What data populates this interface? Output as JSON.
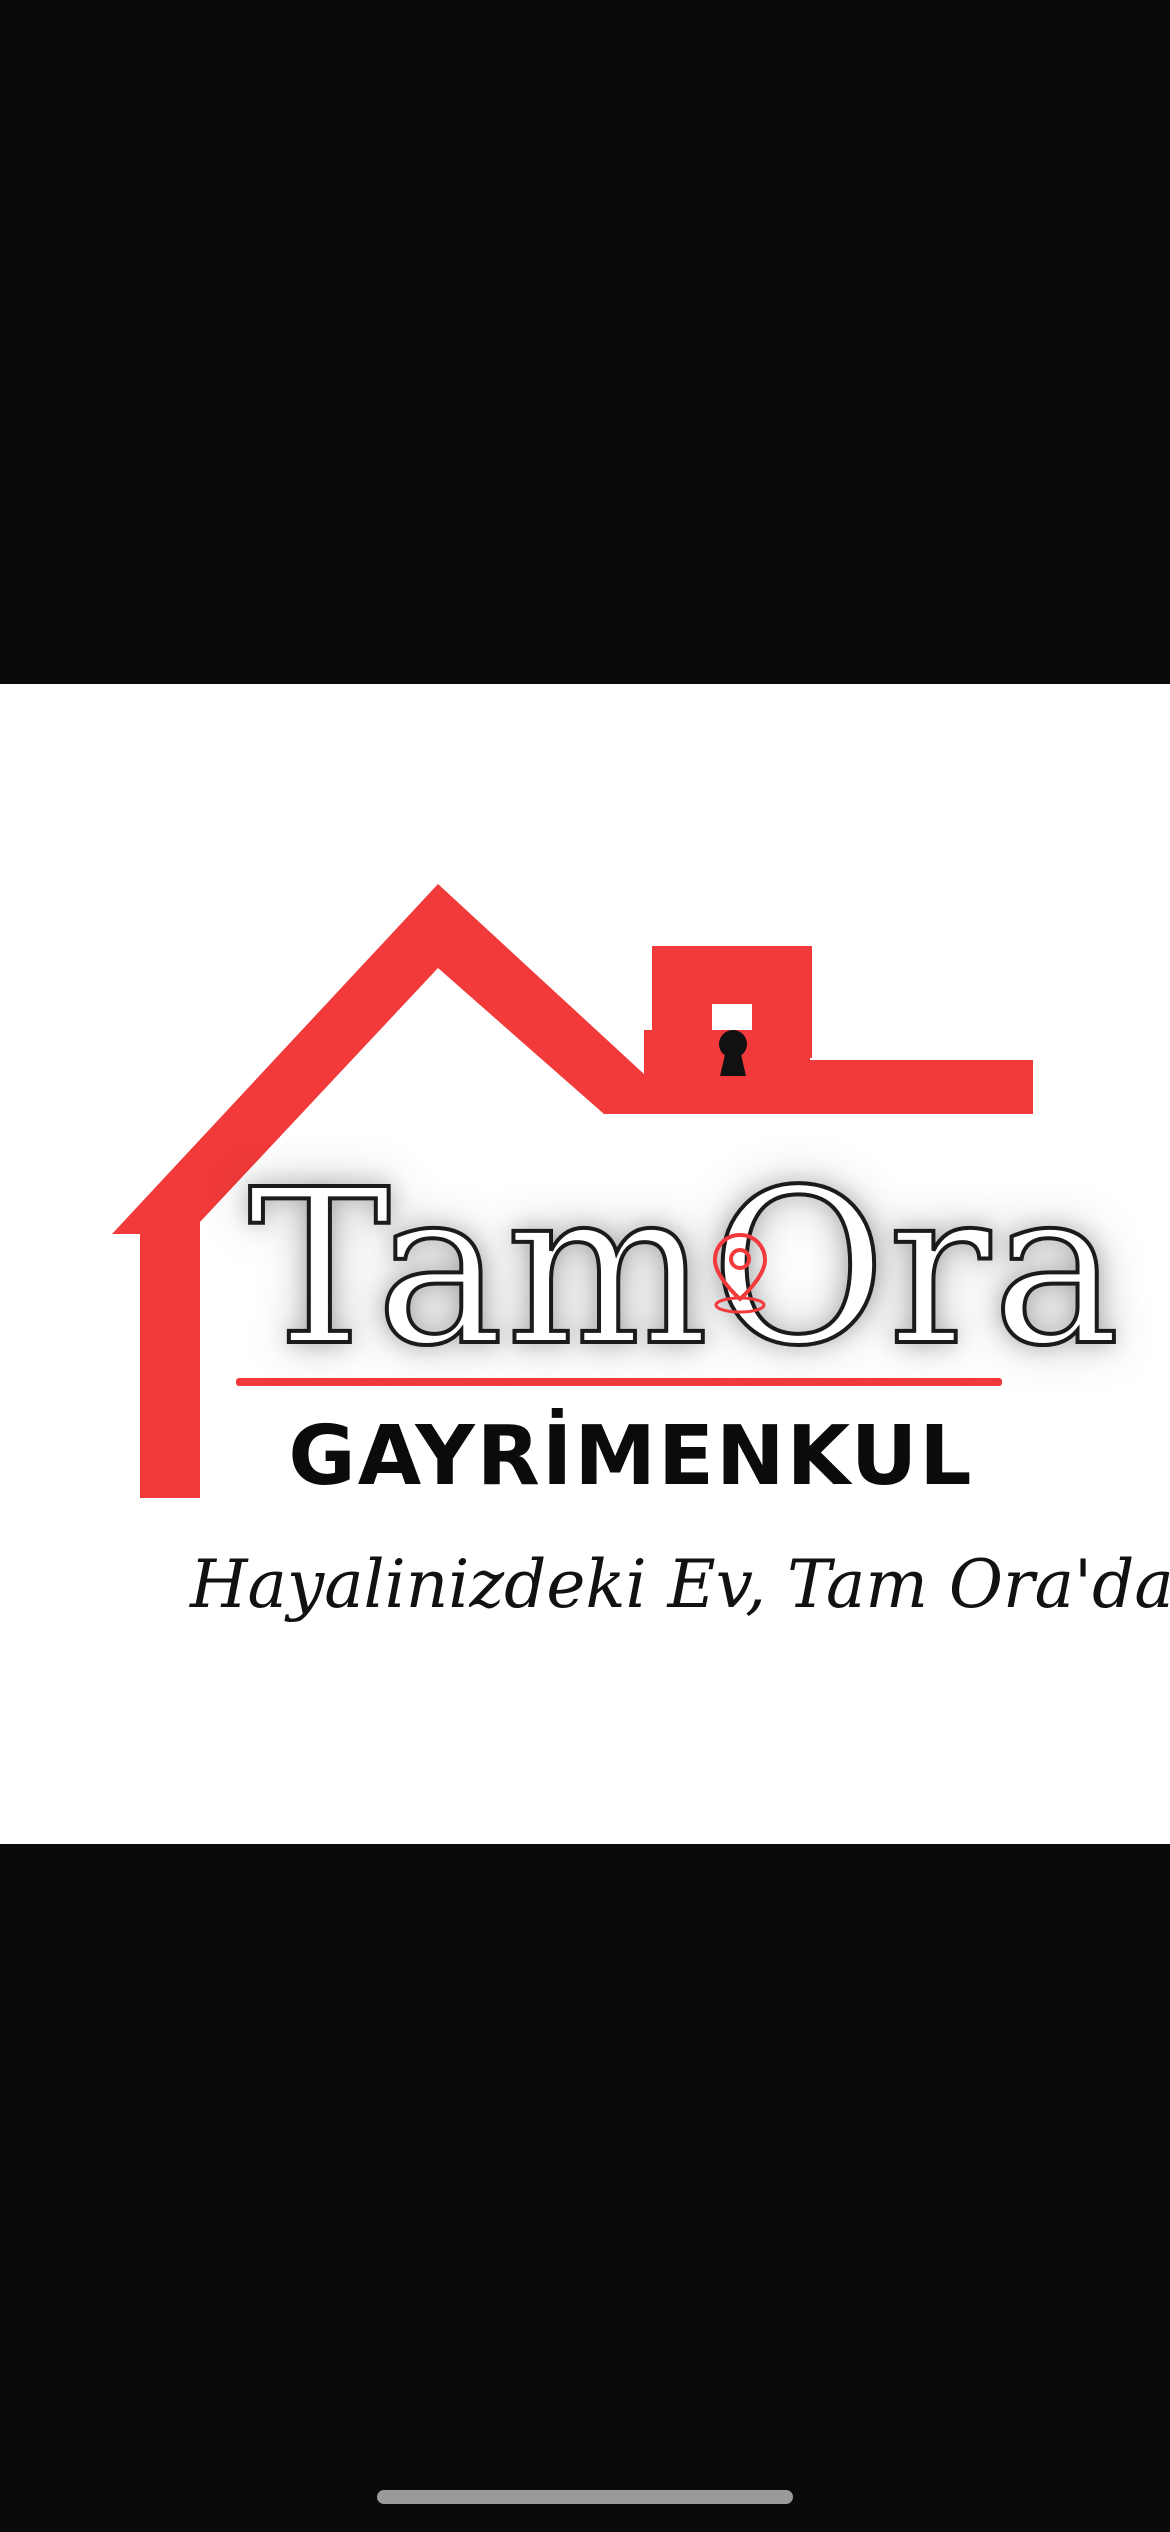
{
  "logo": {
    "brand_name": "TamOra",
    "brand_subtitle": "GAYRİMENKUL",
    "tagline": "Hayalinizdeki Ev, Tam Ora'da",
    "icons": [
      "house-roof-icon",
      "keyhole-icon",
      "location-pin-icon"
    ],
    "colors": {
      "accent": "#f23a3a",
      "text_dark": "#0b0b0b",
      "background": "#ffffff",
      "letterbox": "#0a0a0a"
    }
  }
}
